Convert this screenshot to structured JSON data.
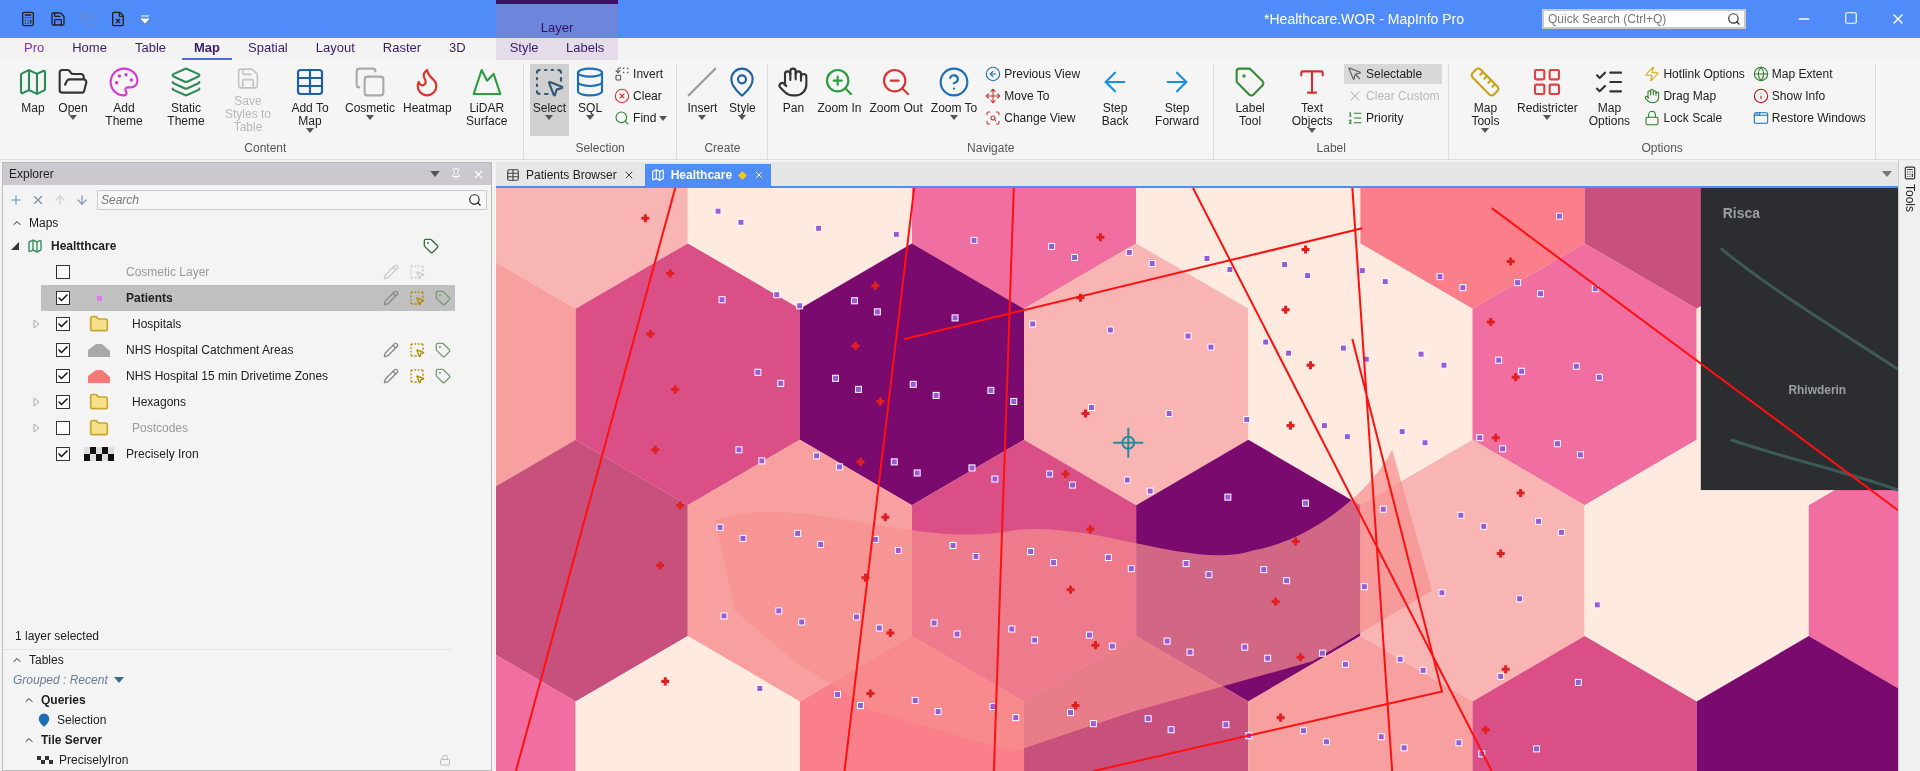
{
  "window": {
    "title": "*Healthcare.WOR - MapInfo Pro",
    "quick_search": {
      "placeholder": "Quick Search (Ctrl+Q)"
    }
  },
  "ribbon_tabs": [
    {
      "label": "Pro",
      "kind": "file",
      "selected": false
    },
    {
      "label": "Home",
      "kind": "tab",
      "selected": false
    },
    {
      "label": "Table",
      "kind": "tab",
      "selected": false
    },
    {
      "label": "Map",
      "kind": "tab",
      "selected": true
    },
    {
      "label": "Spatial",
      "kind": "tab",
      "selected": false
    },
    {
      "label": "Layout",
      "kind": "tab",
      "selected": false
    },
    {
      "label": "Raster",
      "kind": "tab",
      "selected": false
    },
    {
      "label": "3D",
      "kind": "tab",
      "selected": false
    }
  ],
  "contextual_tab_group": {
    "title": "Layer",
    "tabs": [
      {
        "label": "Style",
        "selected": false
      },
      {
        "label": "Labels",
        "selected": false
      }
    ]
  },
  "ribbon_groups": [
    {
      "title": "Content",
      "items": [
        {
          "kind": "large",
          "label": "Map",
          "dropdown": false,
          "disabled": false,
          "selected": false
        },
        {
          "kind": "large",
          "label": "Open",
          "dropdown": true,
          "disabled": false,
          "selected": false
        },
        {
          "kind": "large",
          "label": "Add Theme",
          "dropdown": false,
          "disabled": false,
          "selected": false
        },
        {
          "kind": "large",
          "label": "Static Theme",
          "dropdown": false,
          "disabled": false,
          "selected": false
        },
        {
          "kind": "large",
          "label": "Save Styles to Table",
          "dropdown": false,
          "disabled": true,
          "selected": false
        },
        {
          "kind": "large",
          "label": "Add To Map",
          "dropdown": true,
          "disabled": false,
          "selected": false
        },
        {
          "kind": "large",
          "label": "Cosmetic",
          "dropdown": true,
          "disabled": false,
          "selected": false
        },
        {
          "kind": "large",
          "label": "Heatmap",
          "dropdown": false,
          "disabled": false,
          "selected": false
        },
        {
          "kind": "large",
          "label": "LiDAR Surface",
          "dropdown": false,
          "disabled": false,
          "selected": false
        }
      ]
    },
    {
      "title": "Selection",
      "items": [
        {
          "kind": "large",
          "label": "Select",
          "dropdown": true,
          "disabled": false,
          "selected": true
        },
        {
          "kind": "large",
          "label": "SQL",
          "dropdown": true,
          "disabled": false,
          "selected": false
        },
        {
          "kind": "stack",
          "items": [
            {
              "label": "Invert",
              "dropdown": false,
              "disabled": false,
              "selected": false
            },
            {
              "label": "Clear",
              "dropdown": false,
              "disabled": false,
              "selected": false
            },
            {
              "label": "Find",
              "dropdown": true,
              "disabled": false,
              "selected": false
            }
          ]
        }
      ]
    },
    {
      "title": "Create",
      "items": [
        {
          "kind": "large",
          "label": "Insert",
          "dropdown": true,
          "disabled": false,
          "selected": false
        },
        {
          "kind": "large",
          "label": "Style",
          "dropdown": true,
          "disabled": false,
          "selected": false
        }
      ]
    },
    {
      "title": "Navigate",
      "items": [
        {
          "kind": "large",
          "label": "Pan",
          "dropdown": false,
          "disabled": false,
          "selected": false
        },
        {
          "kind": "large",
          "label": "Zoom In",
          "dropdown": false,
          "disabled": false,
          "selected": false
        },
        {
          "kind": "large",
          "label": "Zoom Out",
          "dropdown": false,
          "disabled": false,
          "selected": false
        },
        {
          "kind": "large",
          "label": "Zoom To",
          "dropdown": true,
          "disabled": false,
          "selected": false
        },
        {
          "kind": "stack",
          "items": [
            {
              "label": "Previous View",
              "dropdown": false,
              "disabled": false,
              "selected": false
            },
            {
              "label": "Move To",
              "dropdown": false,
              "disabled": false,
              "selected": false
            },
            {
              "label": "Change View",
              "dropdown": false,
              "disabled": false,
              "selected": false
            }
          ]
        },
        {
          "kind": "large",
          "label": "Step Back",
          "dropdown": false,
          "disabled": false,
          "selected": false
        },
        {
          "kind": "large",
          "label": "Step Forward",
          "dropdown": false,
          "disabled": false,
          "selected": false
        }
      ]
    },
    {
      "title": "Label",
      "items": [
        {
          "kind": "large",
          "label": "Label Tool",
          "dropdown": false,
          "disabled": false,
          "selected": false
        },
        {
          "kind": "large",
          "label": "Text Objects",
          "dropdown": true,
          "disabled": false,
          "selected": false
        },
        {
          "kind": "stack",
          "items": [
            {
              "label": "Selectable",
              "dropdown": false,
              "disabled": false,
              "selected": true
            },
            {
              "label": "Clear Custom",
              "dropdown": false,
              "disabled": true,
              "selected": false
            },
            {
              "label": "Priority",
              "dropdown": false,
              "disabled": false,
              "selected": false
            }
          ]
        }
      ]
    },
    {
      "title": "Options",
      "items": [
        {
          "kind": "large",
          "label": "Map Tools",
          "dropdown": true,
          "disabled": false,
          "selected": false
        },
        {
          "kind": "large",
          "label": "Redistricter",
          "dropdown": true,
          "disabled": false,
          "selected": false
        },
        {
          "kind": "large",
          "label": "Map Options",
          "dropdown": false,
          "disabled": false,
          "selected": false
        },
        {
          "kind": "stack",
          "items": [
            {
              "label": "Hotlink Options",
              "dropdown": false,
              "disabled": false,
              "selected": false
            },
            {
              "label": "Drag Map",
              "dropdown": false,
              "disabled": false,
              "selected": false
            },
            {
              "label": "Lock Scale",
              "dropdown": false,
              "disabled": false,
              "selected": false
            }
          ]
        },
        {
          "kind": "stack",
          "items": [
            {
              "label": "Map Extent",
              "dropdown": false,
              "disabled": false,
              "selected": false
            },
            {
              "label": "Show Info",
              "dropdown": false,
              "disabled": false,
              "selected": false
            },
            {
              "label": "Restore Windows",
              "dropdown": false,
              "disabled": false,
              "selected": false
            }
          ]
        }
      ]
    }
  ],
  "explorer": {
    "title": "Explorer",
    "search": {
      "placeholder": "Search"
    },
    "maps_section": {
      "label": "Maps",
      "expanded": true
    },
    "map": {
      "name": "Healtthcare",
      "expanded": true,
      "layers": [
        {
          "name": "Cosmetic Layer",
          "kind": "cosmetic",
          "checked": false,
          "selected": false
        },
        {
          "name": "Patients",
          "kind": "point",
          "checked": true,
          "selected": true
        },
        {
          "name": "Hospitals",
          "kind": "folder",
          "checked": true,
          "selected": false,
          "expanded": false
        },
        {
          "name": "NHS Hospital Catchment Areas",
          "kind": "region",
          "checked": true,
          "selected": false
        },
        {
          "name": "NHS Hospital 15 min Drivetime Zones",
          "kind": "drivetime",
          "checked": true,
          "selected": false
        },
        {
          "name": "Hexagons",
          "kind": "folder",
          "checked": true,
          "selected": false,
          "expanded": false
        },
        {
          "name": "Postcodes",
          "kind": "folder",
          "checked": false,
          "selected": false,
          "expanded": false
        },
        {
          "name": "Precisely Iron",
          "kind": "raster",
          "checked": true,
          "selected": false
        }
      ]
    },
    "status": "1 layer selected",
    "tables_section": {
      "label": "Tables",
      "expanded": true,
      "grouping": "Grouped : Recent",
      "groups": [
        {
          "label": "Queries",
          "expanded": true,
          "tables": [
            {
              "name": "Selection",
              "kind": "query"
            }
          ]
        },
        {
          "label": "Tile Server",
          "expanded": true,
          "tables": [
            {
              "name": "PreciselyIron",
              "kind": "tile"
            }
          ]
        }
      ]
    }
  },
  "document_tabs": [
    {
      "label": "Patients Browser",
      "kind": "browser",
      "selected": false,
      "modified": false
    },
    {
      "label": "Healthcare",
      "kind": "map",
      "selected": true,
      "modified": true
    }
  ],
  "map_view": {
    "place_labels": [
      {
        "text": "Risca"
      },
      {
        "text": "Rhiwderin"
      }
    ]
  },
  "tools_panel": {
    "label": "Tools"
  }
}
